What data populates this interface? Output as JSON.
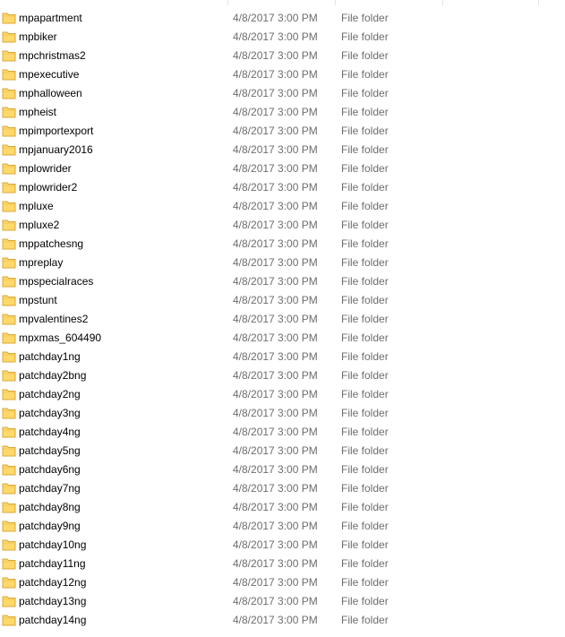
{
  "colors": {
    "folder_fill": "#ffd86a",
    "folder_edge": "#d9a83a",
    "secondary_text": "#6d6d6d"
  },
  "icons": {
    "row_icon": "folder-icon"
  },
  "files": [
    {
      "name": "mpapartment",
      "date": "4/8/2017 3:00 PM",
      "type": "File folder"
    },
    {
      "name": "mpbiker",
      "date": "4/8/2017 3:00 PM",
      "type": "File folder"
    },
    {
      "name": "mpchristmas2",
      "date": "4/8/2017 3:00 PM",
      "type": "File folder"
    },
    {
      "name": "mpexecutive",
      "date": "4/8/2017 3:00 PM",
      "type": "File folder"
    },
    {
      "name": "mphalloween",
      "date": "4/8/2017 3:00 PM",
      "type": "File folder"
    },
    {
      "name": "mpheist",
      "date": "4/8/2017 3:00 PM",
      "type": "File folder"
    },
    {
      "name": "mpimportexport",
      "date": "4/8/2017 3:00 PM",
      "type": "File folder"
    },
    {
      "name": "mpjanuary2016",
      "date": "4/8/2017 3:00 PM",
      "type": "File folder"
    },
    {
      "name": "mplowrider",
      "date": "4/8/2017 3:00 PM",
      "type": "File folder"
    },
    {
      "name": "mplowrider2",
      "date": "4/8/2017 3:00 PM",
      "type": "File folder"
    },
    {
      "name": "mpluxe",
      "date": "4/8/2017 3:00 PM",
      "type": "File folder"
    },
    {
      "name": "mpluxe2",
      "date": "4/8/2017 3:00 PM",
      "type": "File folder"
    },
    {
      "name": "mppatchesng",
      "date": "4/8/2017 3:00 PM",
      "type": "File folder"
    },
    {
      "name": "mpreplay",
      "date": "4/8/2017 3:00 PM",
      "type": "File folder"
    },
    {
      "name": "mpspecialraces",
      "date": "4/8/2017 3:00 PM",
      "type": "File folder"
    },
    {
      "name": "mpstunt",
      "date": "4/8/2017 3:00 PM",
      "type": "File folder"
    },
    {
      "name": "mpvalentines2",
      "date": "4/8/2017 3:00 PM",
      "type": "File folder"
    },
    {
      "name": "mpxmas_604490",
      "date": "4/8/2017 3:00 PM",
      "type": "File folder"
    },
    {
      "name": "patchday1ng",
      "date": "4/8/2017 3:00 PM",
      "type": "File folder"
    },
    {
      "name": "patchday2bng",
      "date": "4/8/2017 3:00 PM",
      "type": "File folder"
    },
    {
      "name": "patchday2ng",
      "date": "4/8/2017 3:00 PM",
      "type": "File folder"
    },
    {
      "name": "patchday3ng",
      "date": "4/8/2017 3:00 PM",
      "type": "File folder"
    },
    {
      "name": "patchday4ng",
      "date": "4/8/2017 3:00 PM",
      "type": "File folder"
    },
    {
      "name": "patchday5ng",
      "date": "4/8/2017 3:00 PM",
      "type": "File folder"
    },
    {
      "name": "patchday6ng",
      "date": "4/8/2017 3:00 PM",
      "type": "File folder"
    },
    {
      "name": "patchday7ng",
      "date": "4/8/2017 3:00 PM",
      "type": "File folder"
    },
    {
      "name": "patchday8ng",
      "date": "4/8/2017 3:00 PM",
      "type": "File folder"
    },
    {
      "name": "patchday9ng",
      "date": "4/8/2017 3:00 PM",
      "type": "File folder"
    },
    {
      "name": "patchday10ng",
      "date": "4/8/2017 3:00 PM",
      "type": "File folder"
    },
    {
      "name": "patchday11ng",
      "date": "4/8/2017 3:00 PM",
      "type": "File folder"
    },
    {
      "name": "patchday12ng",
      "date": "4/8/2017 3:00 PM",
      "type": "File folder"
    },
    {
      "name": "patchday13ng",
      "date": "4/8/2017 3:00 PM",
      "type": "File folder"
    },
    {
      "name": "patchday14ng",
      "date": "4/8/2017 3:00 PM",
      "type": "File folder"
    }
  ]
}
